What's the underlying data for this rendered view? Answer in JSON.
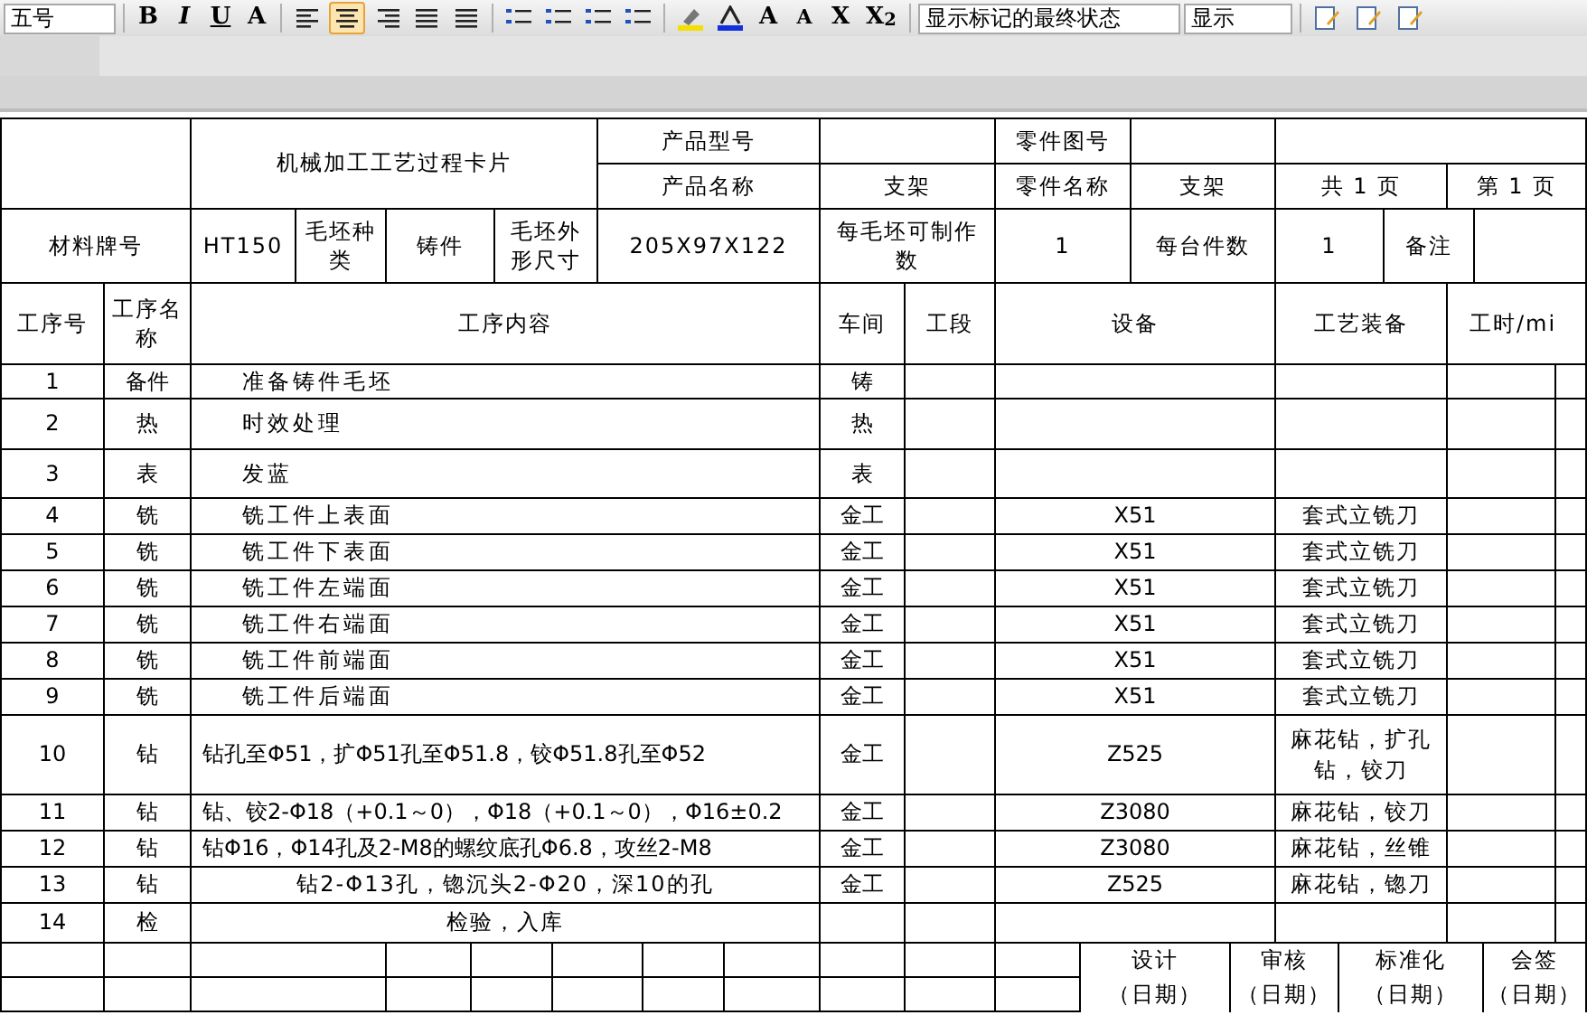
{
  "toolbar": {
    "font_size": "五号",
    "format_buttons": [
      {
        "label": "B"
      },
      {
        "label": "I"
      },
      {
        "label": "U"
      },
      {
        "label": "A"
      }
    ],
    "alignment": [
      {
        "selected": false
      },
      {
        "selected": true
      },
      {
        "selected": false
      },
      {
        "selected": false
      },
      {
        "selected": false
      }
    ],
    "script_buttons": [
      "A",
      "A",
      "X",
      "X$_{2}$"
    ],
    "markup_view": "显示标记的最终状态",
    "show_menu": "显示"
  },
  "card": {
    "title": "机械加工工艺过程卡片",
    "header_row_1": [
      "产品型号",
      "零件图号"
    ],
    "header_row_2": [
      "产品名称",
      "支架",
      "零件名称",
      "支架",
      "共 1 页",
      "第  1 页"
    ],
    "material_row": [
      "材料牌号",
      "HT150",
      "毛坯种类",
      "铸件",
      "毛坯外形尺寸",
      "205X97X122",
      "每毛坯可制作数",
      "1",
      "每台件数",
      "1",
      "备注"
    ],
    "columns": [
      "工序号",
      "工序名称",
      "工序内容",
      "车间",
      "工段",
      "设备",
      "工艺装备",
      "工时/mi"
    ],
    "rows": [
      {
        "no": "1",
        "name": "备件",
        "content": "准备铸件毛坯",
        "kind": "indented",
        "workshop": "铸"
      },
      {
        "no": "2",
        "name": "热",
        "content": "时效处理",
        "kind": "indented",
        "workshop": "热"
      },
      {
        "no": "3",
        "name": "表",
        "content": "发蓝",
        "kind": "indented",
        "workshop": "表"
      },
      {
        "no": "4",
        "name": "铣",
        "content": "铣工件上表面",
        "kind": "indented",
        "workshop": "金工",
        "equipment": "X51",
        "tooling": "套式立铣刀"
      },
      {
        "no": "5",
        "name": "铣",
        "content": "铣工件下表面",
        "kind": "indented",
        "workshop": "金工",
        "equipment": "X51",
        "tooling": "套式立铣刀"
      },
      {
        "no": "6",
        "name": "铣",
        "content": "铣工件左端面",
        "kind": "indented",
        "workshop": "金工",
        "equipment": "X51",
        "tooling": "套式立铣刀"
      },
      {
        "no": "7",
        "name": "铣",
        "content": "铣工件右端面",
        "kind": "indented",
        "workshop": "金工",
        "equipment": "X51",
        "tooling": "套式立铣刀"
      },
      {
        "no": "8",
        "name": "铣",
        "content": "铣工件前端面",
        "kind": "indented",
        "workshop": "金工",
        "equipment": "X51",
        "tooling": "套式立铣刀"
      },
      {
        "no": "9",
        "name": "铣",
        "content": "铣工件后端面",
        "kind": "indented",
        "workshop": "金工",
        "equipment": "X51",
        "tooling": "套式立铣刀"
      },
      {
        "no": "10",
        "name": "钻",
        "content": "钻孔至Φ51，扩Φ51孔至Φ51.8，铰Φ51.8孔至Φ52",
        "kind": "left",
        "workshop": "金工",
        "equipment": "Z525",
        "tooling": "麻花钻，扩孔钻，铰刀"
      },
      {
        "no": "11",
        "name": "钻",
        "content": "钻、铰2-Φ18（+0.1～0），Φ18（+0.1～0），Φ16±0.2",
        "kind": "left",
        "workshop": "金工",
        "equipment": "Z3080",
        "tooling": "麻花钻，铰刀"
      },
      {
        "no": "12",
        "name": "钻",
        "content": "钻Φ16，Φ14孔及2-M8的螺纹底孔Φ6.8，攻丝2-M8",
        "kind": "left",
        "workshop": "金工",
        "equipment": "Z3080",
        "tooling": "麻花钻，丝锥"
      },
      {
        "no": "13",
        "name": "钻",
        "content": "钻2-Φ13孔，锪沉头2-Φ20，深10的孔",
        "kind": "centered",
        "workshop": "金工",
        "equipment": "Z525",
        "tooling": "麻花钻，锪刀"
      },
      {
        "no": "14",
        "name": "检",
        "content": "检验，入库",
        "kind": "centered"
      }
    ],
    "signatures": [
      {
        "role": "设计",
        "date": "（日期）"
      },
      {
        "role": "审核",
        "date": "（日期）"
      },
      {
        "role": "标准化",
        "date": "（日期）"
      },
      {
        "role": "会签",
        "date": "（日期）"
      }
    ]
  }
}
